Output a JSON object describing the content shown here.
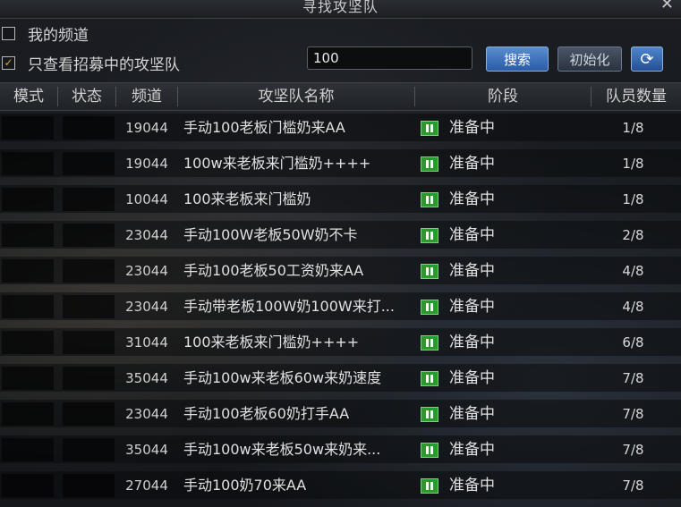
{
  "window": {
    "title": "寻找攻坚队",
    "close_glyph": "✕"
  },
  "filters": {
    "my_channel_label": "我的频道",
    "my_channel_checked": false,
    "recruiting_only_label": "只查看招募中的攻坚队",
    "recruiting_only_checked": true
  },
  "search": {
    "value": "100"
  },
  "buttons": {
    "search": "搜索",
    "reset": "初始化",
    "refresh_glyph": "⟳"
  },
  "columns": [
    "模式",
    "状态",
    "频道",
    "攻坚队名称",
    "阶段",
    "队员数量"
  ],
  "rows": [
    {
      "channel": "19044",
      "name": "手动100老板门槛奶来AA",
      "stage": "准备中",
      "count": "1/8"
    },
    {
      "channel": "19044",
      "name": "100w来老板来门槛奶++++",
      "stage": "准备中",
      "count": "1/8"
    },
    {
      "channel": "10044",
      "name": "100来老板来门槛奶",
      "stage": "准备中",
      "count": "1/8"
    },
    {
      "channel": "23044",
      "name": "手动100W老板50W奶不卡",
      "stage": "准备中",
      "count": "2/8"
    },
    {
      "channel": "23044",
      "name": "手动100老板50工资奶来AA",
      "stage": "准备中",
      "count": "4/8"
    },
    {
      "channel": "23044",
      "name": "手动带老板100W奶100W来打...",
      "stage": "准备中",
      "count": "4/8"
    },
    {
      "channel": "31044",
      "name": "100来老板来门槛奶++++",
      "stage": "准备中",
      "count": "6/8"
    },
    {
      "channel": "35044",
      "name": "手动100w来老板60w来奶速度",
      "stage": "准备中",
      "count": "7/8"
    },
    {
      "channel": "23044",
      "name": "手动100老板60奶打手AA",
      "stage": "准备中",
      "count": "7/8"
    },
    {
      "channel": "35044",
      "name": "手动100w来老板50w来奶来...",
      "stage": "准备中",
      "count": "7/8"
    },
    {
      "channel": "27044",
      "name": "手动100奶70来AA",
      "stage": "准备中",
      "count": "7/8"
    }
  ]
}
